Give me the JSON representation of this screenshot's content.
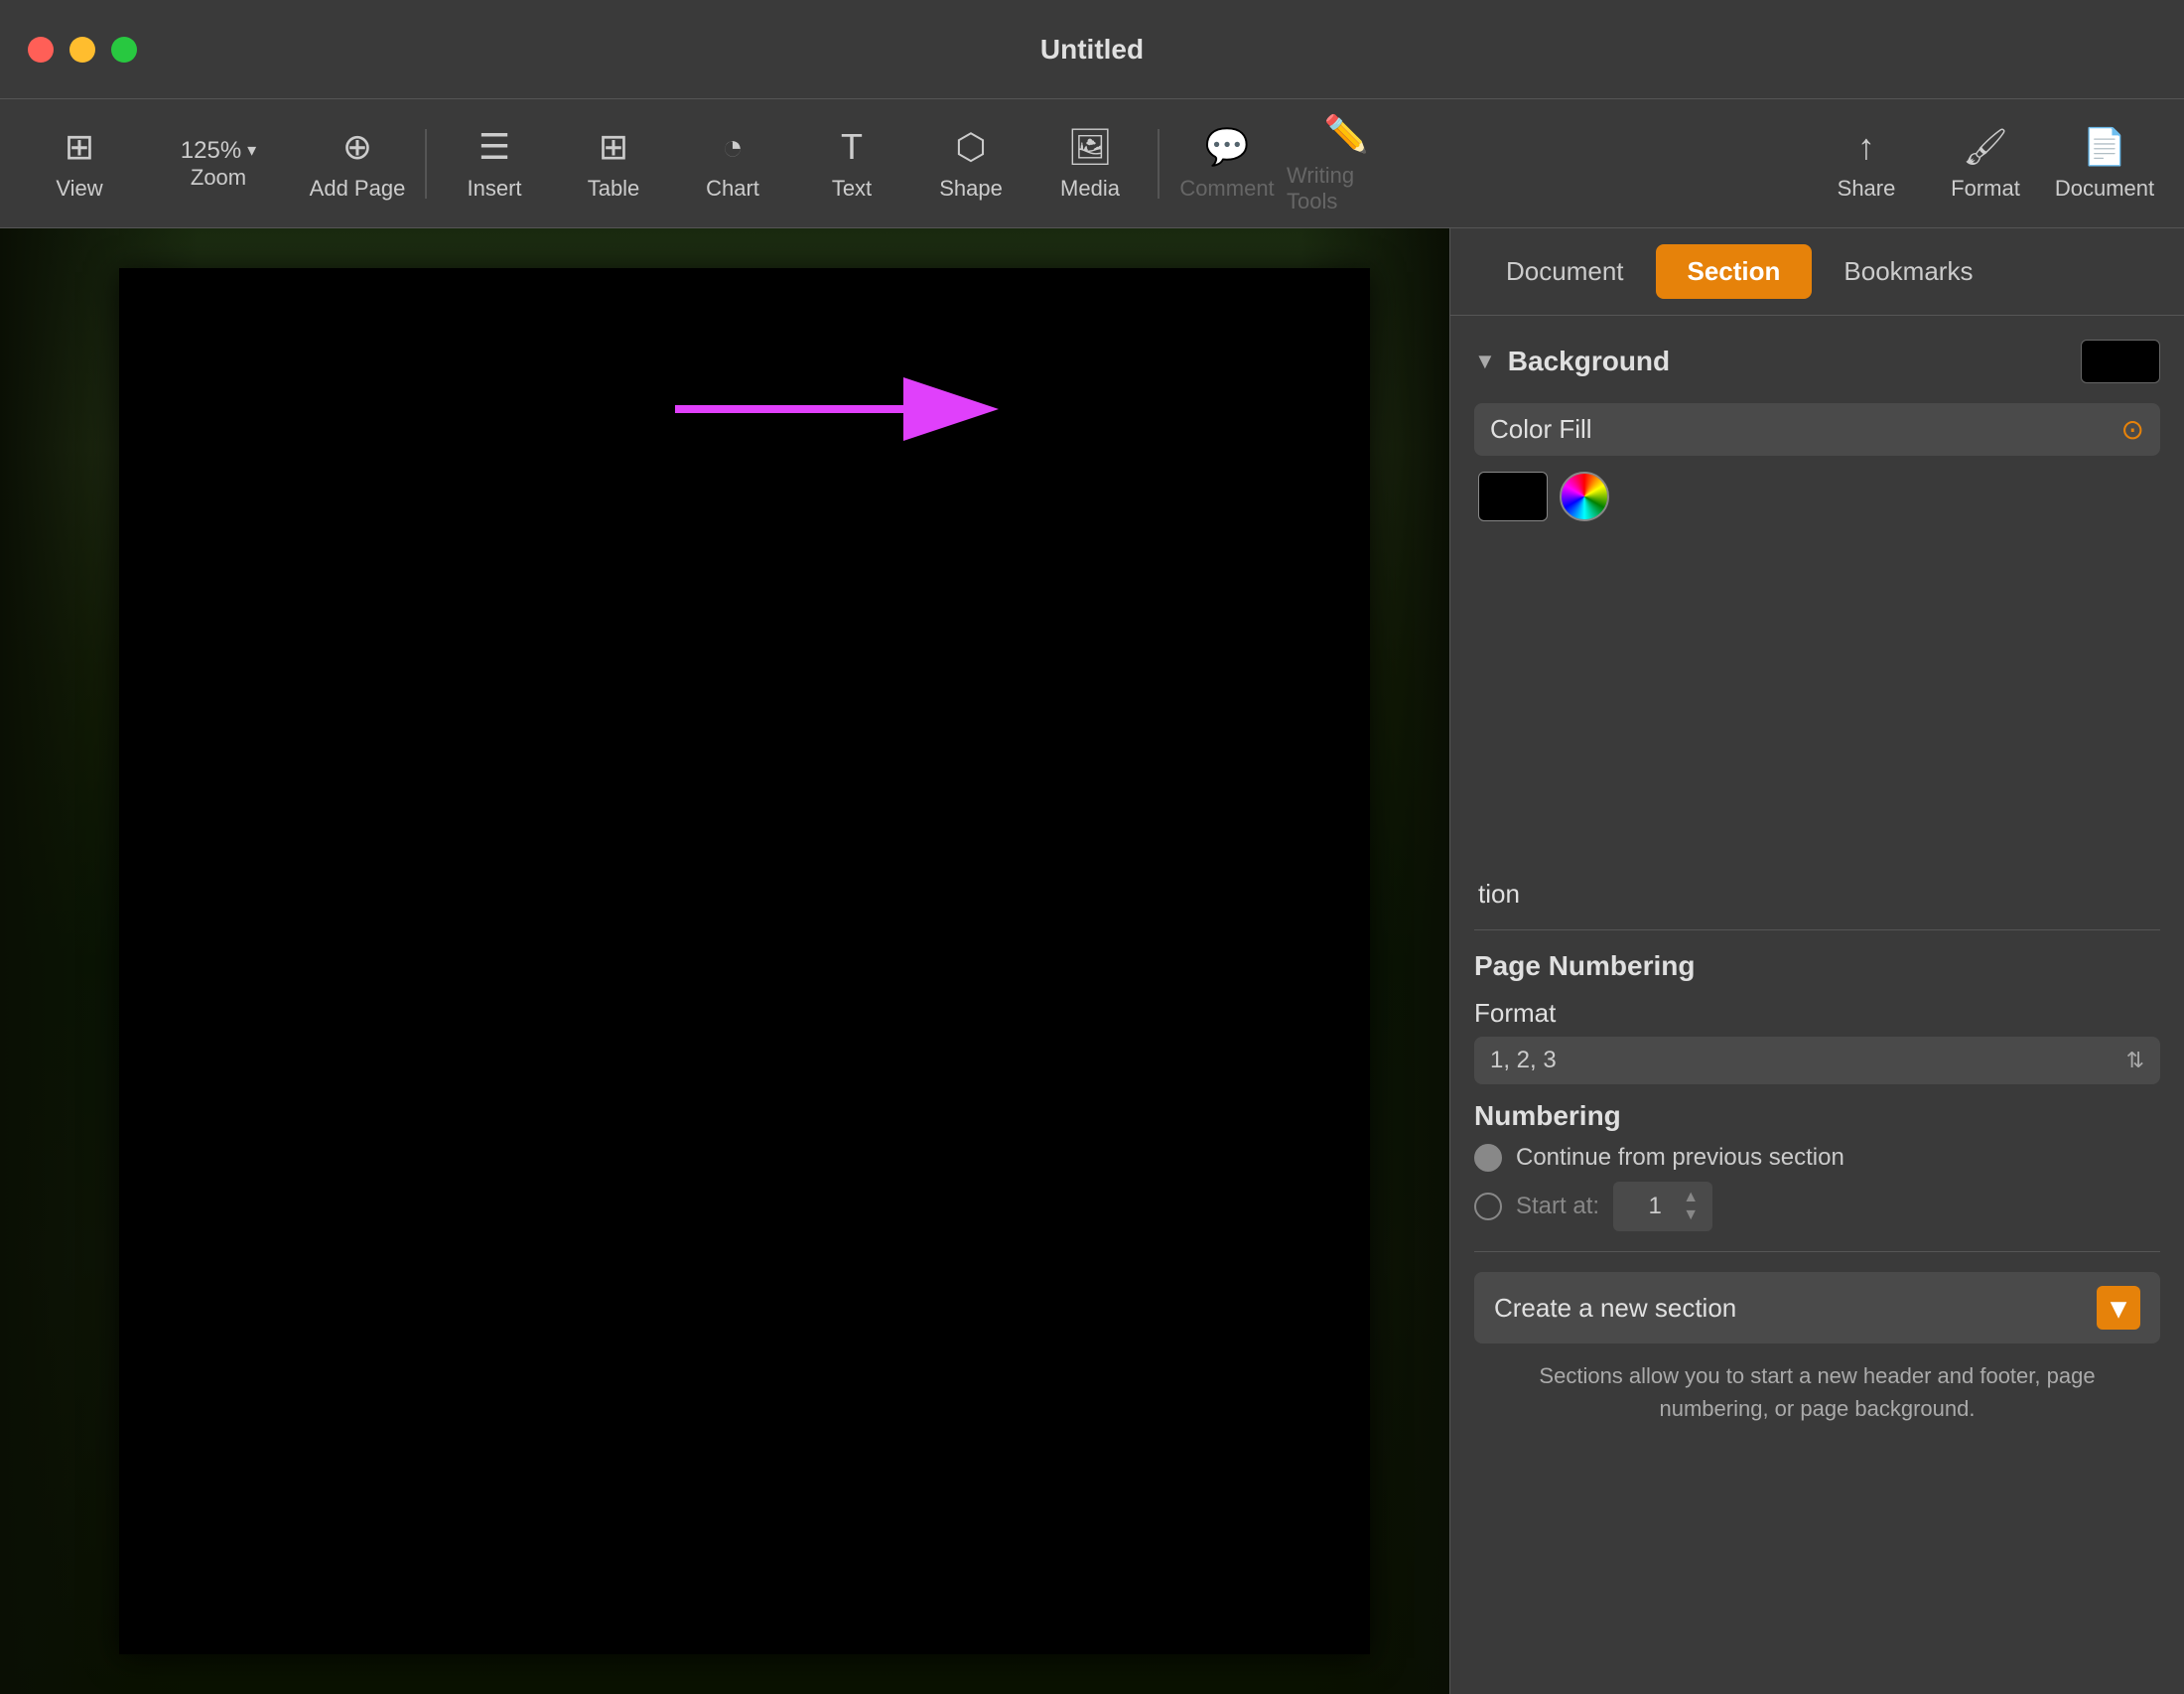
{
  "titlebar": {
    "title": "Untitled"
  },
  "toolbar": {
    "zoom_value": "125%",
    "zoom_label": "Zoom",
    "view_label": "View",
    "add_page_label": "Add Page",
    "insert_label": "Insert",
    "table_label": "Table",
    "chart_label": "Chart",
    "text_label": "Text",
    "shape_label": "Shape",
    "media_label": "Media",
    "comment_label": "Comment",
    "writing_tools_label": "Writing Tools",
    "share_label": "Share",
    "format_label": "Format",
    "document_label": "Document"
  },
  "panel": {
    "tab_document": "Document",
    "tab_section": "Section",
    "tab_bookmarks": "Bookmarks",
    "background_title": "Background",
    "color_fill_label": "Color Fill",
    "page_numbering_title": "Page Numbering",
    "format_label": "Format",
    "format_value": "1, 2, 3",
    "numbering_label": "Numbering",
    "continue_from_previous": "Continue from previous section",
    "start_at_label": "Start at:",
    "start_at_value": "1",
    "create_section_label": "Create a new section",
    "help_text": "Sections allow you to start a new header and footer, page numbering, or page background."
  },
  "color_palette": {
    "colors": [
      [
        "#4a90d9",
        "#5bc8b0",
        "#8fcc4a",
        "#f5d33a",
        "#f0614a",
        "#f06090"
      ],
      [
        "#2e78c8",
        "#3aaa90",
        "#5ab820",
        "#f0a820",
        "#d83020",
        "#e03878"
      ],
      [
        "#2060a8",
        "#2a8870",
        "#3a9010",
        "#e07810",
        "#b82010",
        "#c02060"
      ],
      [
        "#183880",
        "#1a6050",
        "#206800",
        "#c05800",
        "#881808",
        "#901848"
      ]
    ],
    "grays": [
      "#ffffff",
      "#c8c8c8",
      "#989898",
      "#000000"
    ]
  }
}
